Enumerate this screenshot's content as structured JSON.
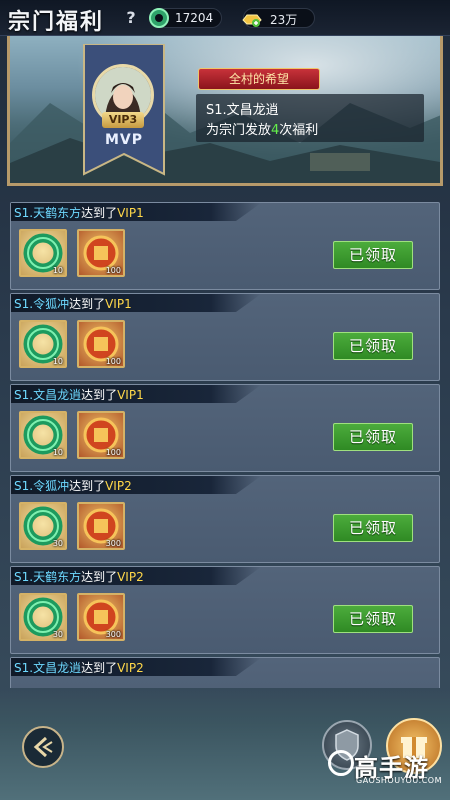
{
  "header": {
    "title": "宗门福利",
    "help": "?",
    "jade_amount": "17204",
    "gold_amount": "23万"
  },
  "banner": {
    "vip_tag": "VIP3",
    "mvp_label": "MVP",
    "ribbon": "全村的希望",
    "line1": "S1.文昌龙逍",
    "line2_prefix": "为宗门发放",
    "line2_count": "4",
    "line2_suffix": "次福利"
  },
  "cards": [
    {
      "name": "S1.天鹤东方",
      "mid": "达到了",
      "vip": "VIP1",
      "jade": "10",
      "coin": "100",
      "button": "已领取"
    },
    {
      "name": "S1.令狐冲",
      "mid": "达到了",
      "vip": "VIP1",
      "jade": "10",
      "coin": "100",
      "button": "已领取"
    },
    {
      "name": "S1.文昌龙逍",
      "mid": "达到了",
      "vip": "VIP1",
      "jade": "10",
      "coin": "100",
      "button": "已领取"
    },
    {
      "name": "S1.令狐冲",
      "mid": "达到了",
      "vip": "VIP2",
      "jade": "30",
      "coin": "300",
      "button": "已领取"
    },
    {
      "name": "S1.天鹤东方",
      "mid": "达到了",
      "vip": "VIP2",
      "jade": "30",
      "coin": "300",
      "button": "已领取"
    },
    {
      "name": "S1.文昌龙逍",
      "mid": "达到了",
      "vip": "VIP2",
      "jade": "",
      "coin": "",
      "button": ""
    }
  ],
  "watermark": {
    "main": "高手游",
    "url": "GAOSHOUYOU.COM"
  },
  "icons": {
    "jade": "jade-ring-icon",
    "gold": "gold-ingot-icon",
    "back": "back-arrow-icon",
    "gift": "gift-box-icon",
    "shield": "sect-shield-icon"
  }
}
